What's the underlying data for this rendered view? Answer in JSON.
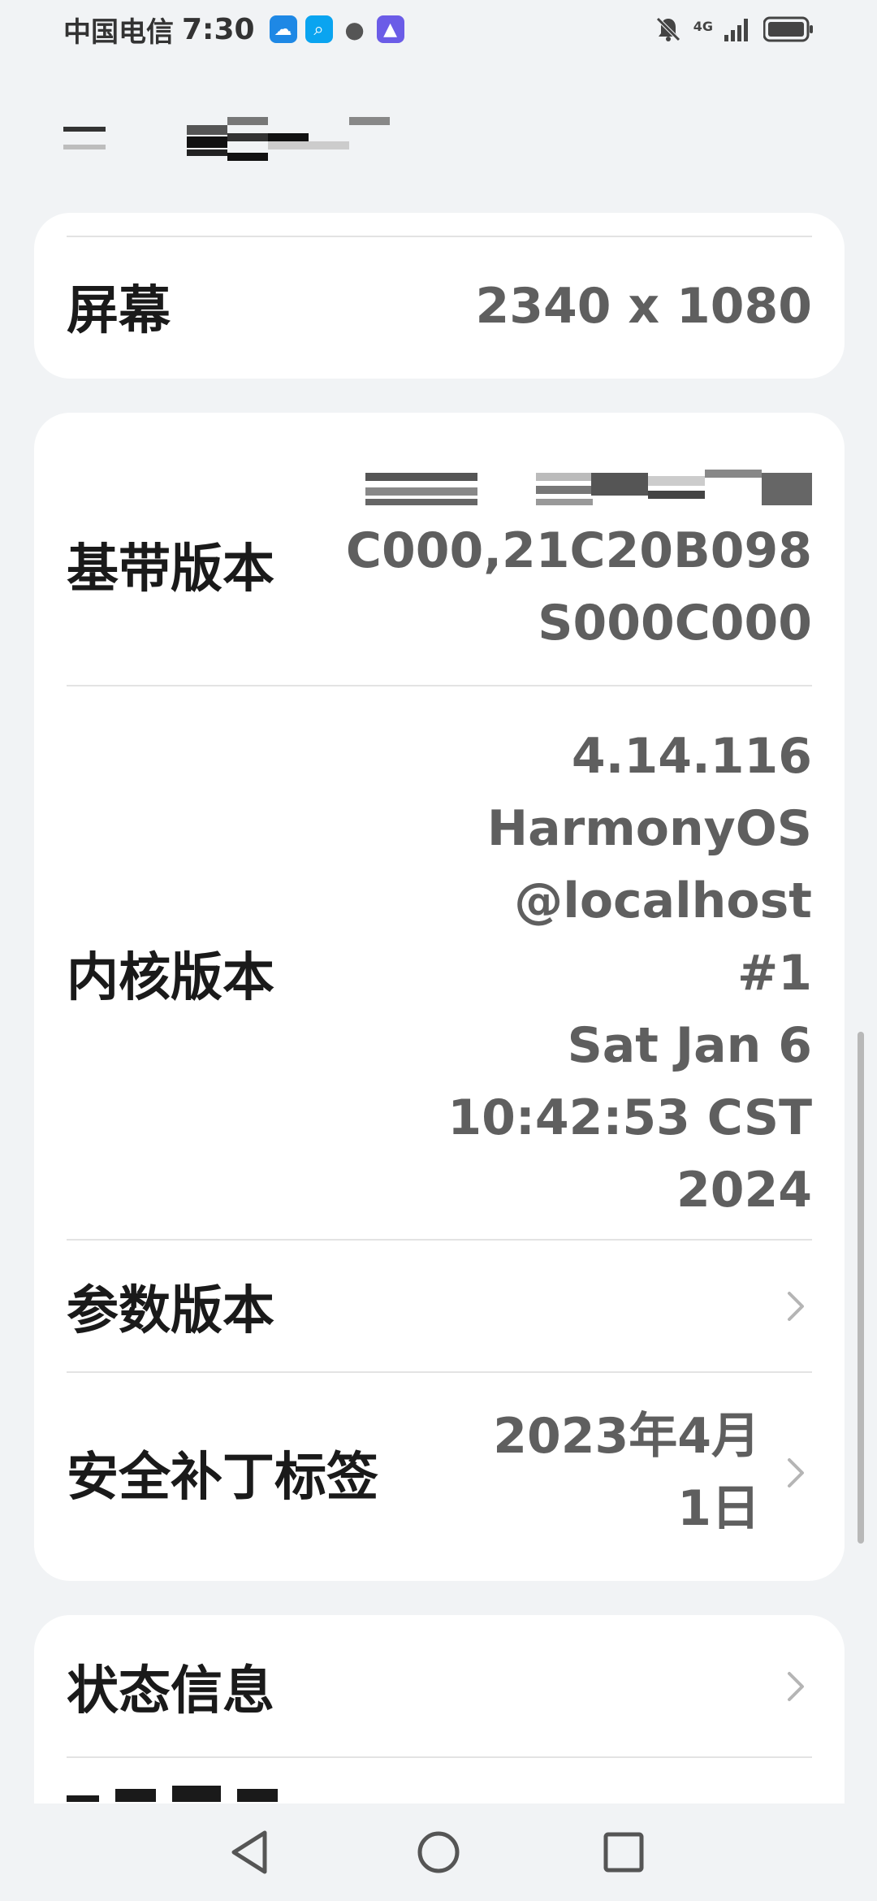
{
  "status_bar": {
    "carrier": "中国电信",
    "time": "7:30",
    "network": "4G"
  },
  "sections": {
    "screen": {
      "label": "屏幕",
      "value": "2340 x 1080"
    },
    "baseband": {
      "label": "基带版本",
      "value_lines": [
        "C000,21C20B098",
        "S000C000"
      ]
    },
    "kernel": {
      "label": "内核版本",
      "value_lines": [
        "4.14.116",
        "HarmonyOS",
        "@localhost",
        "#1",
        "Sat Jan 6",
        "10:42:53 CST",
        "2024"
      ]
    },
    "params": {
      "label": "参数版本"
    },
    "security_patch": {
      "label": "安全补丁标签",
      "value_lines": [
        "2023年4月",
        "1日"
      ]
    },
    "status_info": {
      "label": "状态信息"
    }
  },
  "colors": {
    "background": "#f1f3f5",
    "card": "#ffffff",
    "label": "#1a1a1a",
    "value": "#5f5f5f"
  }
}
